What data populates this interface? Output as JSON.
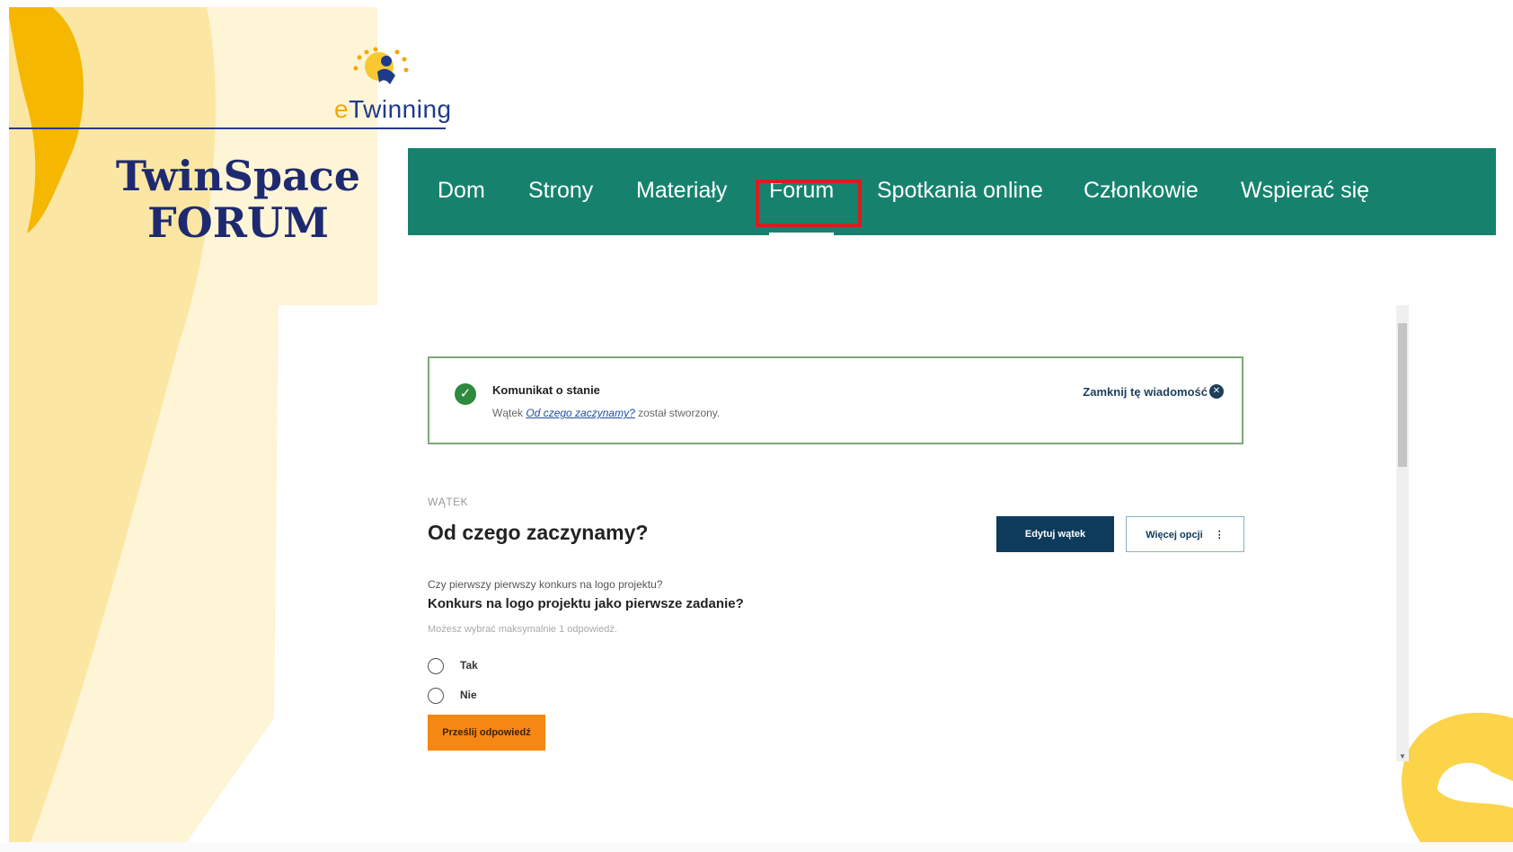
{
  "brand": {
    "logo_name": "eTwinning",
    "logo_prefix": "e",
    "logo_rest": "Twinning"
  },
  "slide_title": {
    "line1": "TwinSpace",
    "line2": "FORUM"
  },
  "nav": {
    "items": [
      "Dom",
      "Strony",
      "Materiały",
      "Forum",
      "Spotkania online",
      "Członkowie",
      "Wspierać się"
    ],
    "active": "Forum"
  },
  "status": {
    "title": "Komunikat o stanie",
    "text_prefix": "Wątek",
    "link": "Od czego zaczynamy?",
    "text_suffix": "został stworzony.",
    "close": "Zamknij tę wiadomość"
  },
  "thread": {
    "eyebrow": "WĄTEK",
    "title": "Od czego zaczynamy?",
    "edit_button": "Edytuj wątek",
    "more_button": "Więcej opcji"
  },
  "poll": {
    "subtitle": "Czy pierwszy pierwszy konkurs na logo projektu?",
    "question": "Konkurs na logo projektu jako pierwsze zadanie?",
    "hint": "Możesz wybrać maksymalnie 1 odpowiedź.",
    "options": [
      "Tak",
      "Nie"
    ],
    "submit": "Prześlij odpowiedź"
  },
  "colors": {
    "nav_bg": "#16826d",
    "highlight": "#d41f1f",
    "submit": "#f68712",
    "primary_button": "#0e3a5c",
    "title": "#1e2a70"
  }
}
